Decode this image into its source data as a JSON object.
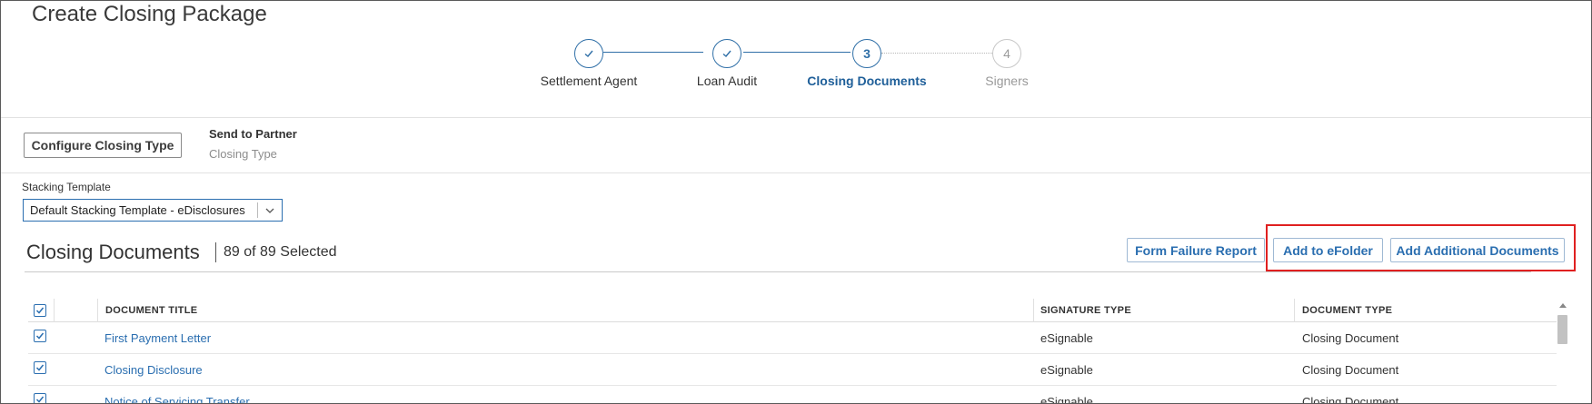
{
  "page": {
    "title": "Create Closing Package"
  },
  "stepper": {
    "steps": [
      {
        "label": "Settlement Agent",
        "state": "complete",
        "icon": "check-icon"
      },
      {
        "label": "Loan Audit",
        "state": "complete",
        "icon": "check-icon"
      },
      {
        "label": "Closing Documents",
        "state": "active",
        "number": "3"
      },
      {
        "label": "Signers",
        "state": "inactive",
        "number": "4"
      }
    ]
  },
  "closing_type": {
    "configure_label": "Configure Closing Type",
    "send_to_partner": "Send to Partner",
    "closing_type_label": "Closing Type"
  },
  "stacking": {
    "label": "Stacking Template",
    "selected": "Default Stacking Template - eDisclosures"
  },
  "documents": {
    "title": "Closing Documents",
    "count": "89 of 89 Selected",
    "buttons": {
      "form_failure": "Form Failure Report",
      "add_efolder": "Add to eFolder",
      "add_additional": "Add Additional Documents"
    },
    "columns": [
      "DOCUMENT TITLE",
      "SIGNATURE TYPE",
      "DOCUMENT TYPE"
    ],
    "rows": [
      {
        "title": "First Payment Letter",
        "signature": "eSignable",
        "type": "Closing Document"
      },
      {
        "title": "Closing Disclosure",
        "signature": "eSignable",
        "type": "Closing Document"
      },
      {
        "title": "Notice of Servicing Transfer",
        "signature": "eSignable",
        "type": "Closing Document"
      }
    ]
  },
  "colors": {
    "accent": "#2a6eb0",
    "highlight": "#e02020"
  }
}
